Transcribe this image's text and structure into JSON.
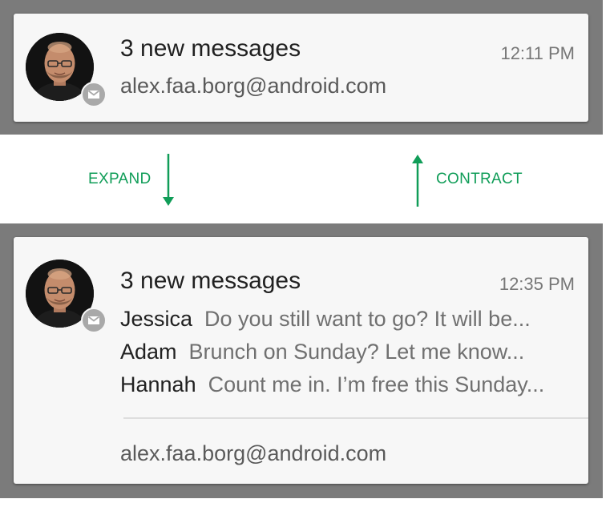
{
  "collapsed": {
    "title": "3 new messages",
    "time": "12:11 PM",
    "account": "alex.faa.borg@android.com"
  },
  "actions": {
    "expand": "EXPAND",
    "contract": "CONTRACT"
  },
  "expanded": {
    "title": "3 new messages",
    "time": "12:35 PM",
    "messages": [
      {
        "sender": "Jessica",
        "snippet": "Do you still want to go? It will be..."
      },
      {
        "sender": "Adam",
        "snippet": "Brunch on Sunday? Let me know..."
      },
      {
        "sender": "Hannah",
        "snippet": "Count me in. I’m free this Sunday..."
      }
    ],
    "account": "alex.faa.borg@android.com"
  },
  "icons": {
    "app_badge": "gmail-icon",
    "expand": "arrow-down-icon",
    "contract": "arrow-up-icon"
  },
  "colors": {
    "accent": "#109d58",
    "background_band": "#7b7b7b",
    "card": "#f7f7f7",
    "badge": "#a9a9a9"
  }
}
